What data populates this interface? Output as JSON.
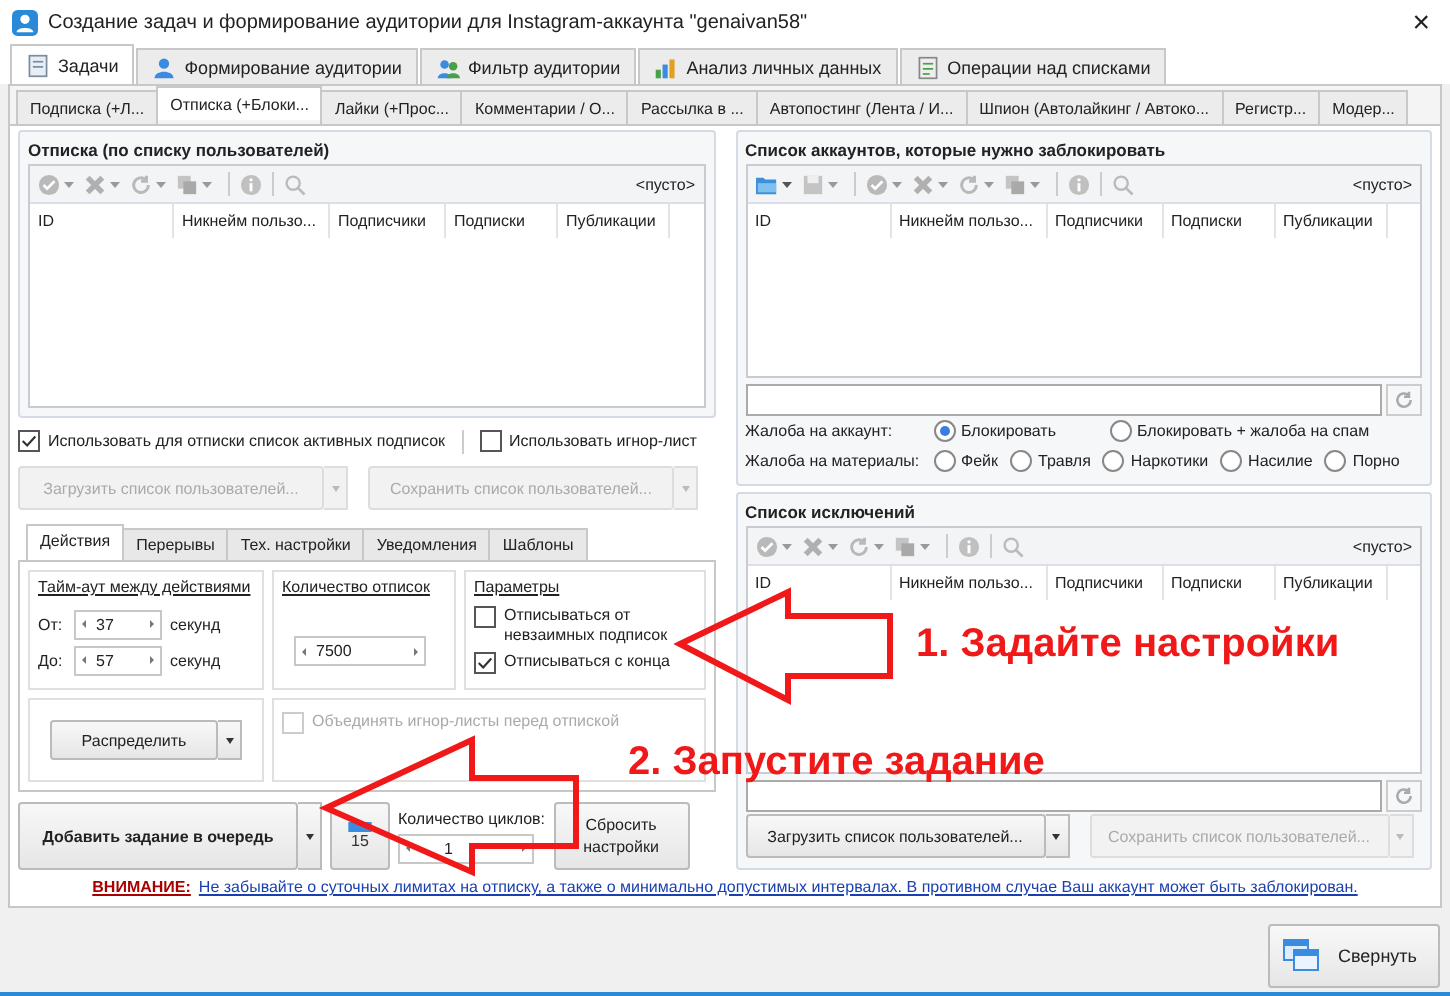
{
  "window": {
    "title": "Создание задач и формирование аудитории для Instagram-аккаунта \"genaivan58\"",
    "close": "×"
  },
  "main_tabs": [
    {
      "label": "Задачи",
      "selected": true
    },
    {
      "label": "Формирование аудитории",
      "selected": false
    },
    {
      "label": "Фильтр аудитории",
      "selected": false
    },
    {
      "label": "Анализ личных данных",
      "selected": false
    },
    {
      "label": "Операции над списками",
      "selected": false
    }
  ],
  "sub_tabs": [
    {
      "label": "Подписка (+Л...",
      "selected": false
    },
    {
      "label": "Отписка (+Блоки...",
      "selected": true
    },
    {
      "label": "Лайки (+Прос...",
      "selected": false
    },
    {
      "label": "Комментарии / О...",
      "selected": false
    },
    {
      "label": "Рассылка в ...",
      "selected": false
    },
    {
      "label": "Автопостинг (Лента / И...",
      "selected": false
    },
    {
      "label": "Шпион (Автолайкинг / Автоко...",
      "selected": false
    },
    {
      "label": "Регистр...",
      "selected": false
    },
    {
      "label": "Модер...",
      "selected": false
    }
  ],
  "unfollow_panel": {
    "title": "Отписка  (по списку пользователей)",
    "status": "<пусто>",
    "columns": [
      "ID",
      "Никнейм пользо...",
      "Подписчики",
      "Подписки",
      "Публикации"
    ]
  },
  "options": [
    {
      "label": "Использовать для отписки список активных подписок",
      "checked": true
    },
    {
      "label": "Использовать игнор-лист",
      "checked": false
    }
  ],
  "list_buttons": [
    {
      "label": "Загрузить список пользователей...",
      "disabled": true
    },
    {
      "label": "Сохранить список пользователей...",
      "disabled": true
    }
  ],
  "settings_tabs": [
    {
      "label": "Действия",
      "selected": true
    },
    {
      "label": "Перерывы",
      "selected": false
    },
    {
      "label": "Тех. настройки",
      "selected": false
    },
    {
      "label": "Уведомления",
      "selected": false
    },
    {
      "label": "Шаблоны",
      "selected": false
    }
  ],
  "timeout": {
    "title": "Тайм-аут между действиями",
    "rows": [
      {
        "label": "От:",
        "value": "37",
        "unit": "секунд"
      },
      {
        "label": "До:",
        "value": "57",
        "unit": "секунд"
      }
    ]
  },
  "count": {
    "title": "Количество отписок",
    "value": "7500"
  },
  "params": {
    "title": "Параметры",
    "items": [
      {
        "label": "Отписываться от невзаимных подписок",
        "checked": false
      },
      {
        "label": "Отписываться с конца",
        "checked": true
      }
    ]
  },
  "distribute_button": "Распределить",
  "merge_option": {
    "label": "Объединять игнор-листы перед отпиской",
    "checked": false,
    "disabled": true
  },
  "add_task_button": "Добавить задание в очередь",
  "calendar_day": "15",
  "cycles": {
    "label": "Количество циклов:",
    "value": "1"
  },
  "reset_button": "Сбросить настройки",
  "block_panel": {
    "title": "Список аккаунтов, которые нужно заблокировать",
    "status": "<пусто>",
    "columns": [
      "ID",
      "Никнейм пользо...",
      "Подписчики",
      "Подписки",
      "Публикации"
    ],
    "account_complaint": {
      "label": "Жалоба на аккаунт:",
      "options": [
        {
          "label": "Блокировать",
          "selected": true
        },
        {
          "label": "Блокировать + жалоба на спам",
          "selected": false
        }
      ]
    },
    "content_complaint": {
      "label": "Жалоба на материалы:",
      "options": [
        {
          "label": "Фейк",
          "selected": false
        },
        {
          "label": "Травля",
          "selected": false
        },
        {
          "label": "Наркотики",
          "selected": false
        },
        {
          "label": "Насилие",
          "selected": false
        },
        {
          "label": "Порно",
          "selected": false
        }
      ]
    }
  },
  "exclusions_panel": {
    "title": "Список исключений",
    "status": "<пусто>",
    "columns": [
      "ID",
      "Никнейм пользо...",
      "Подписчики",
      "Подписки",
      "Публикации"
    ],
    "buttons": [
      {
        "label": "Загрузить список пользователей...",
        "disabled": false
      },
      {
        "label": "Сохранить список пользователей...",
        "disabled": true
      }
    ]
  },
  "warning": {
    "label": "ВНИМАНИЕ:",
    "text": "Не забывайте о суточных лимитах на отписку, а также о минимально допустимых интервалах. В противном случае Ваш аккаунт может быть заблокирован."
  },
  "collapse_button": "Свернуть",
  "annotations": [
    "1. Задайте настройки",
    "2. Запустите задание"
  ]
}
